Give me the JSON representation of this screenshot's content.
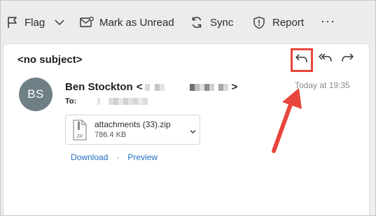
{
  "toolbar": {
    "flag_label": "Flag",
    "mark_unread_label": "Mark as Unread",
    "sync_label": "Sync",
    "report_label": "Report",
    "more_label": "···"
  },
  "message": {
    "subject": "<no subject>",
    "avatar_initials": "BS",
    "sender_name": "Ben Stockton",
    "sender_open": "<",
    "sender_close": ">",
    "to_label": "To:",
    "time": "Today at 19:35"
  },
  "attachment": {
    "file_name": "attachments (33).zip",
    "file_size": "786.4 KB",
    "file_type_text": "ZIP"
  },
  "actions": {
    "download_label": "Download",
    "separator": "·",
    "preview_label": "Preview"
  },
  "colors": {
    "highlight_red": "#e8453c",
    "avatar_bg": "#6f7f86",
    "link_blue": "#1f6fbf"
  }
}
